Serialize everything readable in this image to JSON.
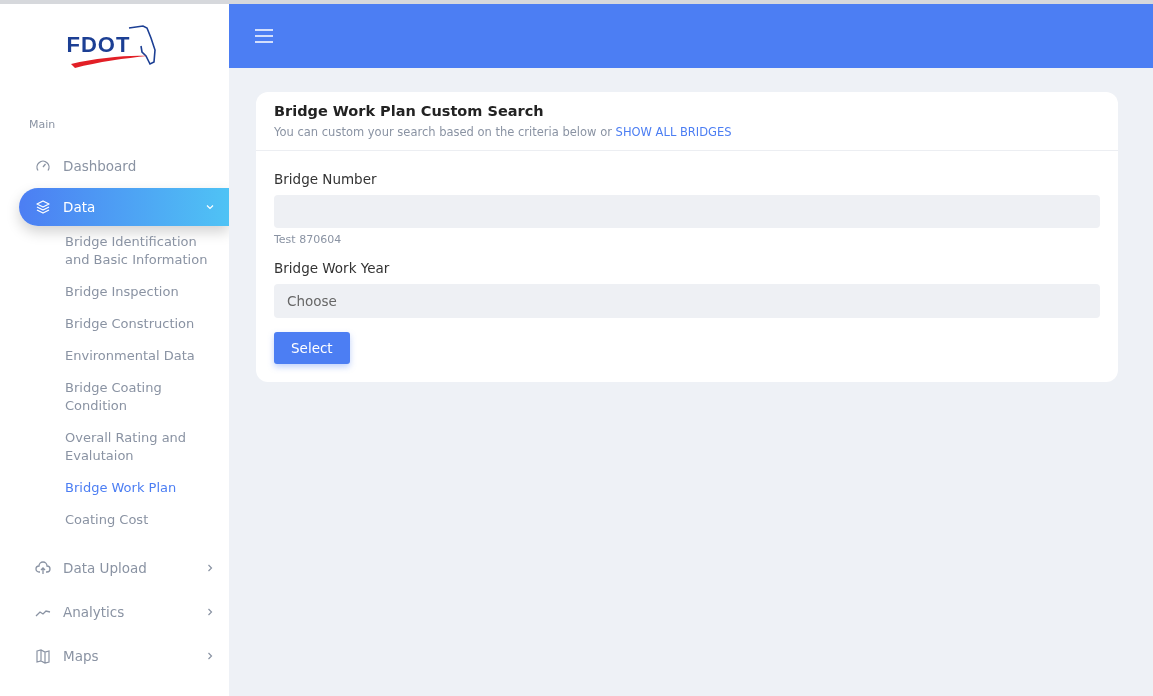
{
  "logo": "FDOT",
  "sidebar": {
    "section": "Main",
    "items": [
      {
        "label": "Dashboard",
        "selected": false
      },
      {
        "label": "Data",
        "selected": true,
        "expanded": true,
        "children": [
          {
            "label": "Bridge Identification and Basic Information",
            "selected": false
          },
          {
            "label": "Bridge Inspection",
            "selected": false
          },
          {
            "label": "Bridge Construction",
            "selected": false
          },
          {
            "label": "Environmental Data",
            "selected": false
          },
          {
            "label": "Bridge Coating Condition",
            "selected": false
          },
          {
            "label": "Overall Rating and Evalutaion",
            "selected": false
          },
          {
            "label": "Bridge Work Plan",
            "selected": true
          },
          {
            "label": "Coating Cost",
            "selected": false
          }
        ]
      },
      {
        "label": "Data Upload",
        "selected": false,
        "expanded": false
      },
      {
        "label": "Analytics",
        "selected": false,
        "expanded": false
      },
      {
        "label": "Maps",
        "selected": false,
        "expanded": false
      }
    ]
  },
  "card": {
    "title": "Bridge Work Plan Custom Search",
    "subtitle": "You can custom your search based on the criteria below or",
    "link": "SHOW ALL BRIDGES",
    "fields": [
      {
        "kind": "text",
        "label": "Bridge Number",
        "help": "Test 870604"
      },
      {
        "kind": "select",
        "label": "Bridge Work Year",
        "placeholder": "Choose"
      }
    ],
    "button": "Select"
  }
}
